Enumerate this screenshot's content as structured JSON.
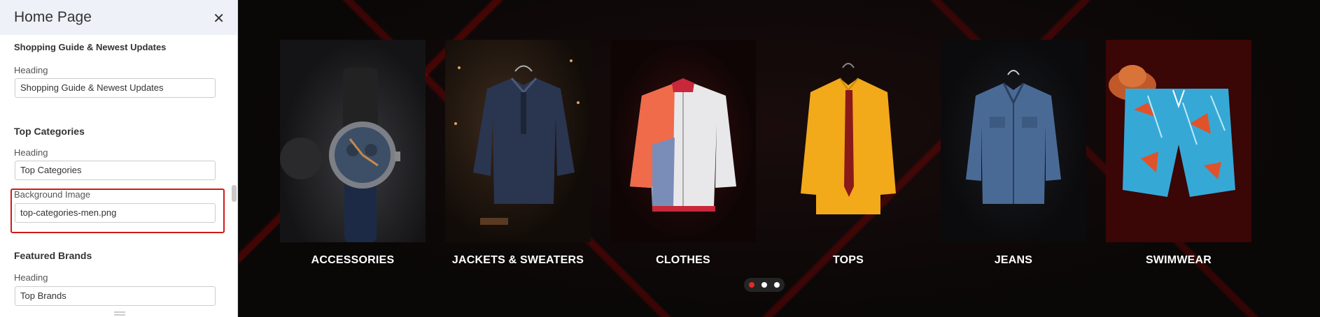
{
  "panel": {
    "title": "Home Page",
    "sections": [
      {
        "title": "Shopping Guide & Newest Updates",
        "field_label": "Heading",
        "field_value": "Shopping Guide & Newest Updates"
      },
      {
        "title": "Top Categories",
        "field_label": "Heading",
        "field_value": "Top Categories",
        "bg_label": "Background Image",
        "bg_value": "top-categories-men.png"
      },
      {
        "title": "Featured Brands",
        "field_label": "Heading",
        "field_value": "Top Brands"
      }
    ]
  },
  "categories": [
    "ACCESSORIES",
    "JACKETS & SWEATERS",
    "CLOTHES",
    "TOPS",
    "JEANS",
    "SWIMWEAR"
  ],
  "carousel": {
    "pages": 3,
    "active_index": 0
  },
  "colors": {
    "accent": "#e02b2b",
    "highlight": "#d11a1a",
    "panel_header": "#eef1f7"
  }
}
